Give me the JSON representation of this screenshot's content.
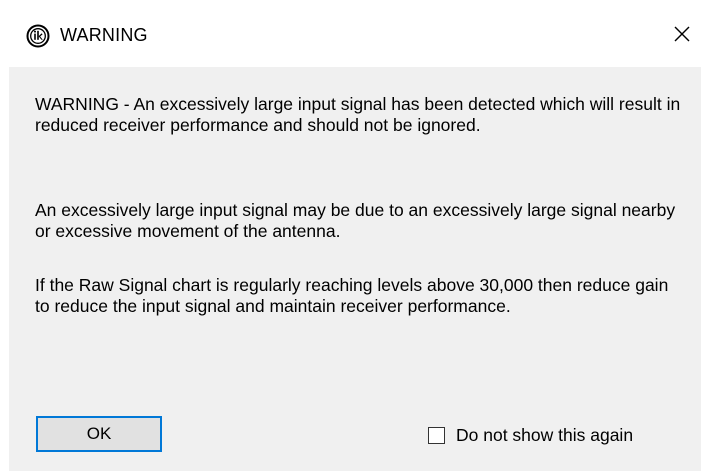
{
  "window": {
    "title": "WARNING",
    "app_icon": "ik-logo-icon",
    "close_icon": "close-icon"
  },
  "message": {
    "paragraph_1": "WARNING - An excessively large input signal has been detected which will result in reduced receiver performance and should not be ignored.",
    "paragraph_2": "An excessively large input signal may be due to an excessively large signal nearby or excessive movement of the antenna.",
    "paragraph_3": "If the Raw Signal chart is regularly reaching levels above 30,000 then reduce gain to reduce the input signal and maintain receiver performance."
  },
  "buttons": {
    "ok_label": "OK"
  },
  "checkbox": {
    "label": "Do not show this again",
    "checked": false
  },
  "colors": {
    "content_background": "#f0f0f0",
    "button_focus_border": "#0078d7",
    "button_background": "#e1e1e1"
  }
}
